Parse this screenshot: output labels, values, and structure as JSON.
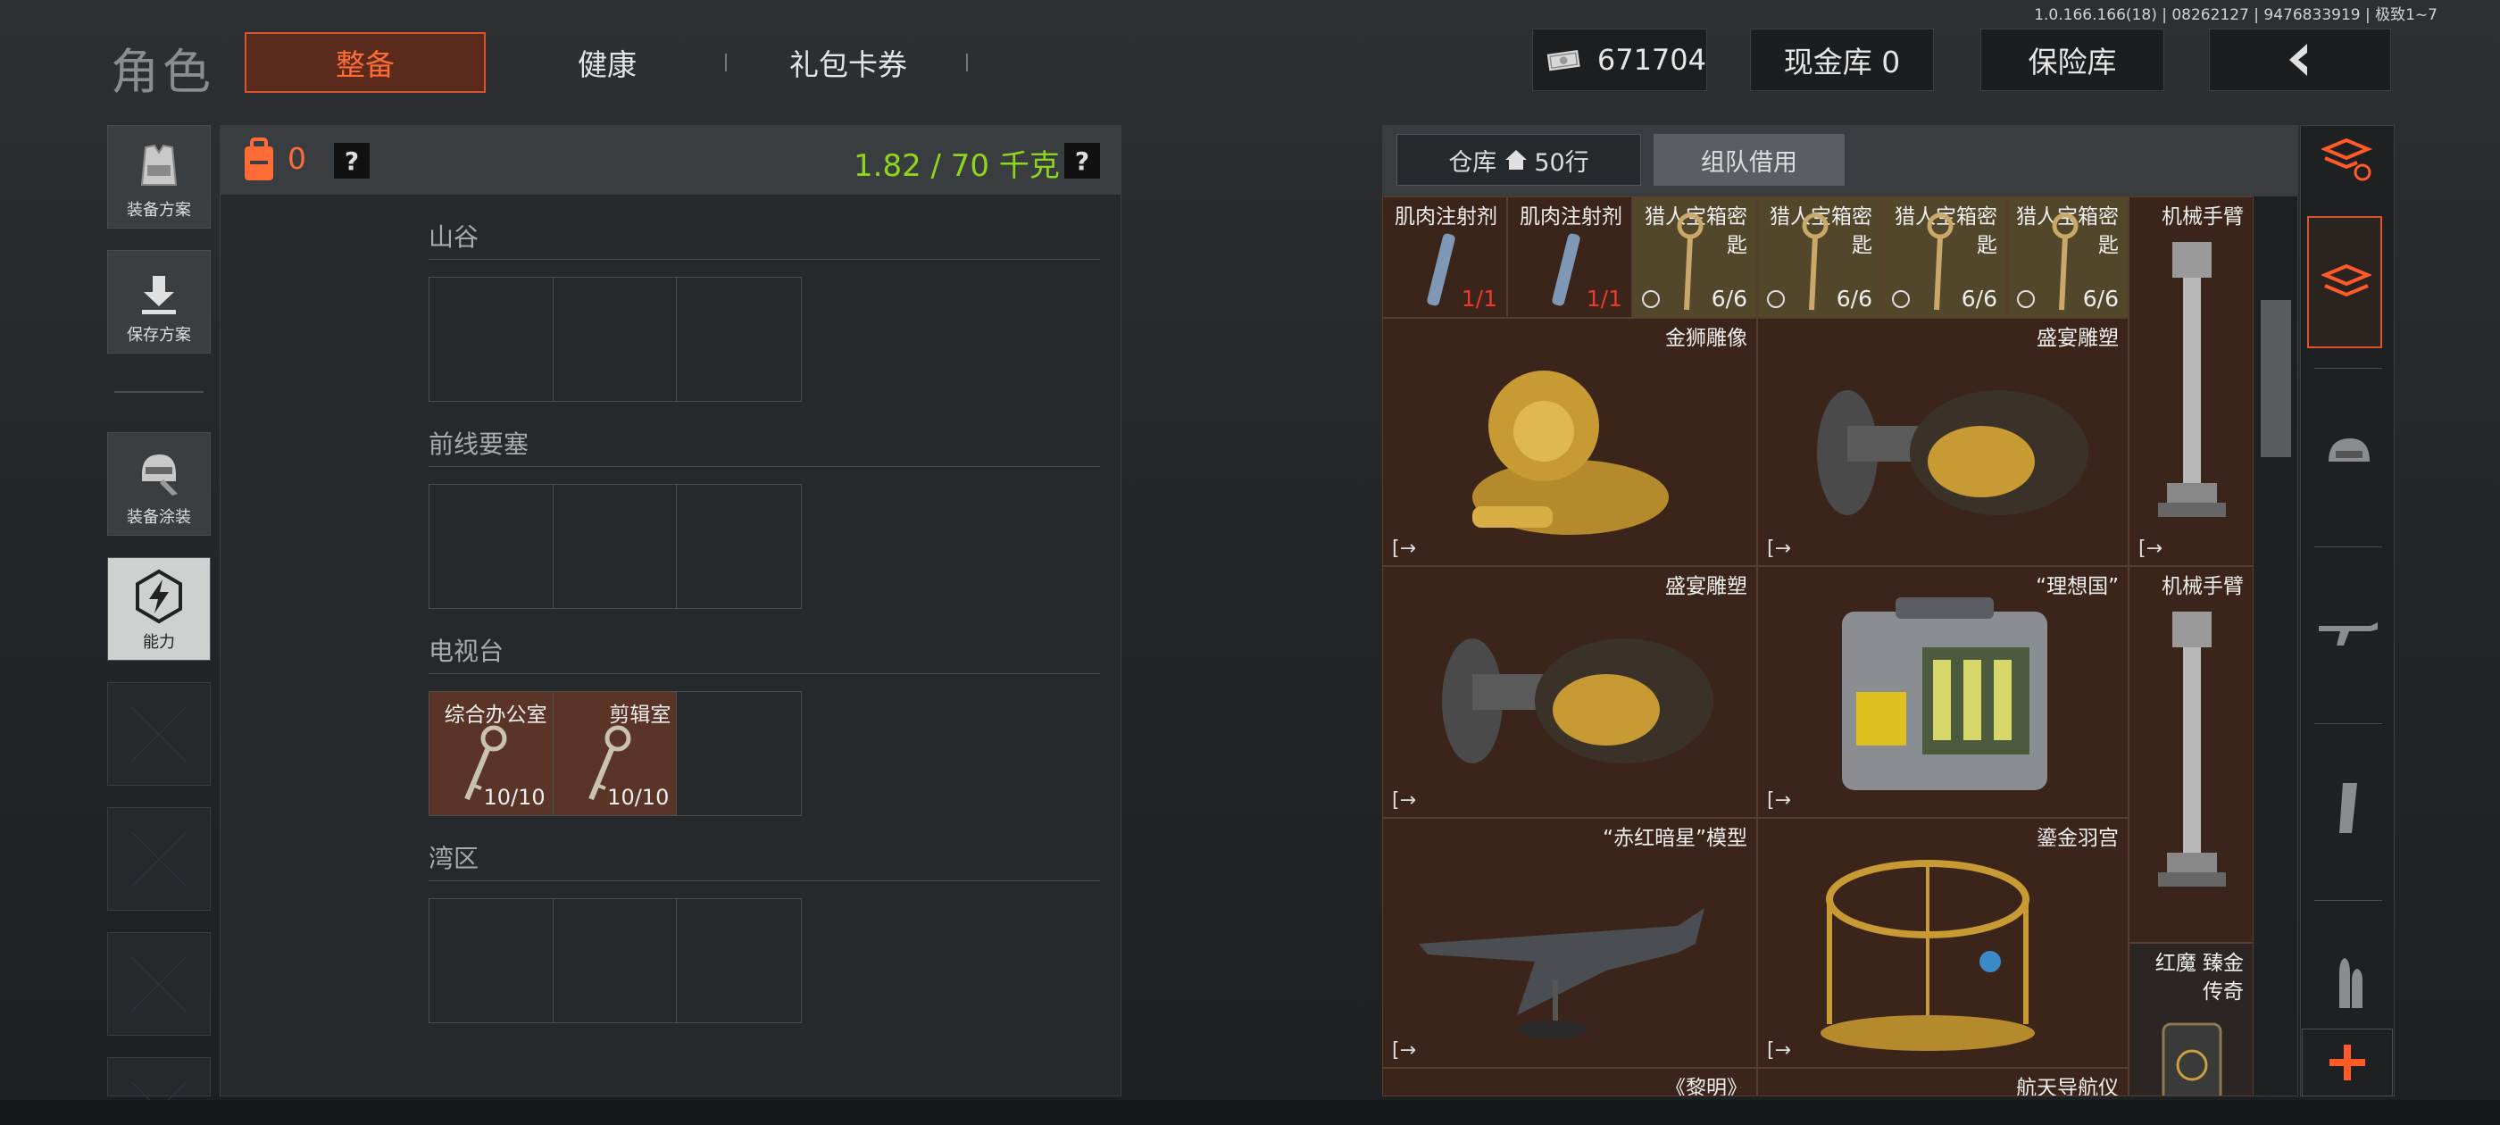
{
  "version": "1.0.166.166(18) | 08262127 | 9476833919 | 极致1~7",
  "header": {
    "title": "角色",
    "tabs": [
      "整备",
      "健康",
      "礼包卡券"
    ],
    "money": "671704",
    "cash_label": "现金库 0",
    "safe_label": "保险库"
  },
  "sidebar": {
    "items": [
      {
        "label": "装备方案",
        "icon": "vest-icon"
      },
      {
        "label": "保存方案",
        "icon": "download-icon"
      },
      {
        "label": "装备涂装",
        "icon": "helmet-paint-icon"
      },
      {
        "label": "能力",
        "icon": "lightning-icon"
      }
    ]
  },
  "loadout": {
    "count": "0",
    "weight": "1.82 / 70 千克",
    "help": "?",
    "sections": [
      {
        "title": "山谷"
      },
      {
        "title": "前线要塞"
      },
      {
        "title": "电视台",
        "keys": [
          {
            "label": "综合办公室",
            "count": "10/10"
          },
          {
            "label": "剪辑室",
            "count": "10/10"
          }
        ]
      },
      {
        "title": "湾区"
      }
    ]
  },
  "warehouse": {
    "tab_warehouse": "仓库",
    "tab_rows": "50行",
    "tab_team": "组队借用",
    "small_items": [
      {
        "name": "肌肉注射剂",
        "count": "1/1"
      },
      {
        "name": "肌肉注射剂",
        "count": "1/1"
      },
      {
        "name": "猎人宝箱密匙",
        "count": "6/6"
      },
      {
        "name": "猎人宝箱密匙",
        "count": "6/6"
      },
      {
        "name": "猎人宝箱密匙",
        "count": "6/6"
      },
      {
        "name": "猎人宝箱密匙",
        "count": "6/6"
      }
    ],
    "items": {
      "robot_arm": "机械手臂",
      "lion": "金狮雕像",
      "feast1": "盛宴雕塑",
      "feast2": "盛宴雕塑",
      "utopia": "“理想国”",
      "robot_arm2": "机械手臂",
      "jet": "“赤红暗星”模型",
      "cage": "鎏金羽宫",
      "redmagic": "红魔 臻金传奇",
      "dawn": "《黎明》",
      "nav": "航天导航仪"
    }
  },
  "colors": {
    "accent": "#ff6b35",
    "weight": "#8ed61a",
    "item_bg": "#3b241a",
    "key_bg": "#52472a"
  }
}
